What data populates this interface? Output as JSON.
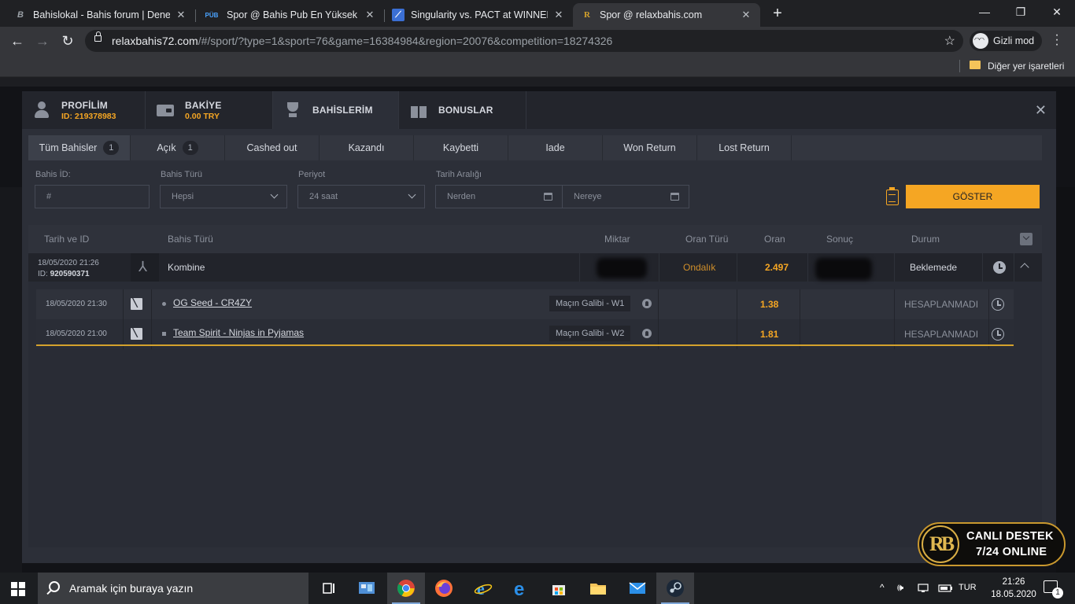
{
  "browser": {
    "tabs": [
      {
        "title": "Bahislokal - Bahis forum | Denem",
        "favicon": "B"
      },
      {
        "title": "Spor @ Bahis Pub En Yüksek Bah",
        "favicon": "PÜB"
      },
      {
        "title": "Singularity vs. PACT at WINNERS",
        "favicon": ""
      },
      {
        "title": "Spor @ relaxbahis.com",
        "favicon": "R"
      }
    ],
    "url_host": "relaxbahis72.com",
    "url_path": "/#/sport/?type=1&sport=76&game=16384984&region=20076&competition=18274326",
    "incognito_label": "Gizli mod",
    "bookmarks_other": "Diğer yer işaretleri"
  },
  "modal": {
    "tabs": [
      {
        "label": "PROFİLİM",
        "sub": "ID: 219378983"
      },
      {
        "label": "BAKİYE",
        "sub": "0.00 TRY"
      },
      {
        "label": "BAHİSLERİM",
        "sub": ""
      },
      {
        "label": "BONUSLAR",
        "sub": ""
      }
    ],
    "subtabs": [
      {
        "label": "Tüm Bahisler",
        "count": "1"
      },
      {
        "label": "Açık",
        "count": "1"
      },
      {
        "label": "Cashed out",
        "count": ""
      },
      {
        "label": "Kazandı",
        "count": ""
      },
      {
        "label": "Kaybetti",
        "count": ""
      },
      {
        "label": "Iade",
        "count": ""
      },
      {
        "label": "Won Return",
        "count": ""
      },
      {
        "label": "Lost Return",
        "count": ""
      }
    ],
    "filters": {
      "bet_id_label": "Bahis İD:",
      "bet_id_placeholder": "#",
      "bet_type_label": "Bahis Türü",
      "bet_type_value": "Hepsi",
      "period_label": "Periyot",
      "period_value": "24 saat",
      "date_range_label": "Tarih Aralığı",
      "from_placeholder": "Nerden",
      "to_placeholder": "Nereye",
      "show_button": "GÖSTER"
    },
    "table": {
      "headers": {
        "date_id": "Tarih ve ID",
        "bet_type": "Bahis Türü",
        "amount": "Miktar",
        "odds_type": "Oran Türü",
        "odds": "Oran",
        "result": "Sonuç",
        "status": "Durum"
      },
      "bet": {
        "date": "18/05/2020 21:26",
        "id_label": "ID:",
        "id": "920590371",
        "type": "Kombine",
        "odds_type": "Ondalık",
        "odds": "2.497",
        "status": "Beklemede"
      },
      "selections": [
        {
          "date": "18/05/2020 21:30",
          "match": "OG Seed - CR4ZY",
          "market": "Maçın Galibi - W1",
          "odds": "1.38",
          "status": "HESAPLANMADI"
        },
        {
          "date": "18/05/2020 21:00",
          "match": "Team Spirit - Ninjas in Pyjamas",
          "market": "Maçın Galibi - W2",
          "odds": "1.81",
          "status": "HESAPLANMADI"
        }
      ]
    }
  },
  "support": {
    "line1": "CANLI DESTEK",
    "line2": "7/24 ONLINE",
    "logo": "RB"
  },
  "taskbar": {
    "search_placeholder": "Aramak için buraya yazın",
    "language": "TUR",
    "time": "21:26",
    "date": "18.05.2020",
    "notifications": "1"
  },
  "colors": {
    "accent": "#f5a623",
    "modal_bg": "#2c2f38",
    "header_bg": "#23252c"
  }
}
